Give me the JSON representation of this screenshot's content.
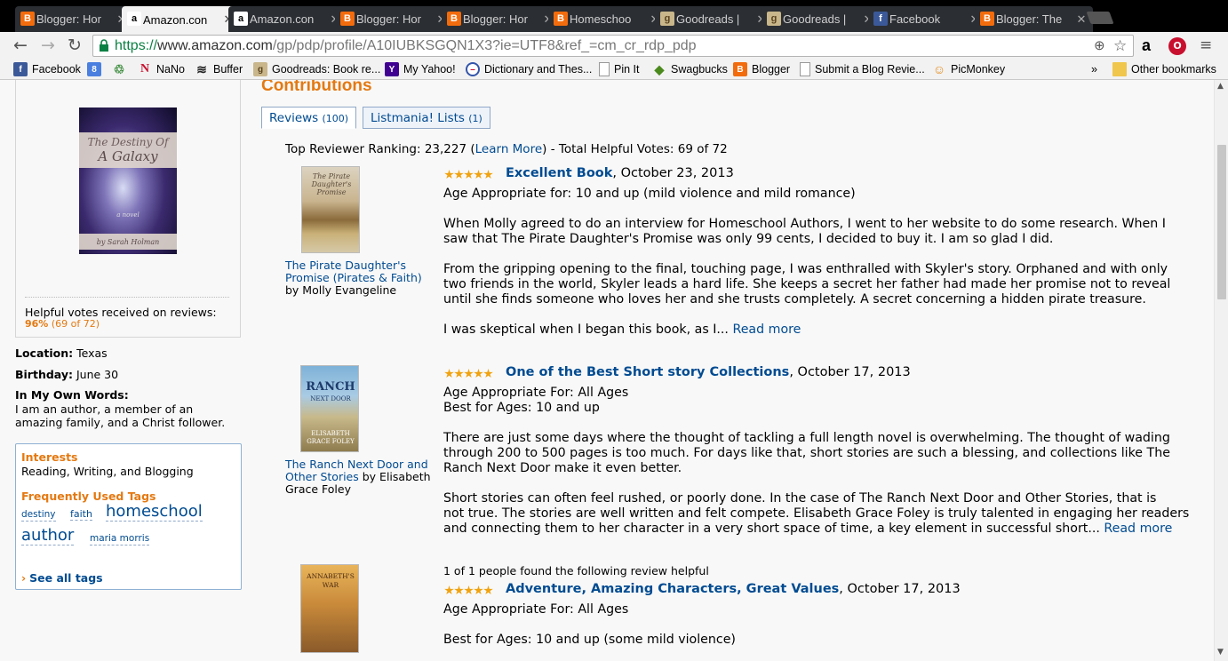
{
  "browser": {
    "tabs": [
      {
        "icon": "blogger",
        "title": "Blogger: Hor"
      },
      {
        "icon": "amazon",
        "title": "Amazon.con",
        "active": true
      },
      {
        "icon": "amazon",
        "title": "Amazon.con"
      },
      {
        "icon": "blogger",
        "title": "Blogger: Hor"
      },
      {
        "icon": "blogger",
        "title": "Blogger: Hor"
      },
      {
        "icon": "homeschool",
        "title": "Homeschoo"
      },
      {
        "icon": "goodreads",
        "title": "Goodreads |"
      },
      {
        "icon": "goodreads",
        "title": "Goodreads |"
      },
      {
        "icon": "facebook",
        "title": "Facebook"
      },
      {
        "icon": "blogger",
        "title": "Blogger: The"
      }
    ],
    "url_scheme": "https://",
    "url_host": "www.amazon.com",
    "url_path": "/gp/pdp/profile/A10IUBKSGQN1X3?ie=UTF8&ref_=cm_cr_rdp_pdp",
    "bookmarks": [
      {
        "label": "Facebook",
        "icon": "facebook"
      },
      {
        "label": "",
        "icon": "google"
      },
      {
        "label": "",
        "icon": "recycle"
      },
      {
        "label": "NaNo",
        "icon": "nano"
      },
      {
        "label": "Buffer",
        "icon": "buffer"
      },
      {
        "label": "Goodreads: Book re...",
        "icon": "goodreads"
      },
      {
        "label": "My Yahoo!",
        "icon": "yahoo"
      },
      {
        "label": "Dictionary and Thes...",
        "icon": "dictionary"
      },
      {
        "label": "Pin It",
        "icon": "page"
      },
      {
        "label": "Swagbucks",
        "icon": "swagbucks"
      },
      {
        "label": "Blogger",
        "icon": "blogger"
      },
      {
        "label": "Submit a Blog Revie...",
        "icon": "page"
      },
      {
        "label": "PicMonkey",
        "icon": "picmonkey"
      }
    ],
    "bookmarks_overflow": "»",
    "other_bookmarks": "Other bookmarks"
  },
  "profile": {
    "cover": {
      "title_line1": "The Destiny Of",
      "title_line2": "A Galaxy",
      "subtitle": "a novel",
      "author": "by Sarah Holman"
    },
    "helpful_label": "Helpful votes received on reviews:",
    "helpful_pct": "96%",
    "helpful_count": "(69 of 72)",
    "location_label": "Location:",
    "location": "Texas",
    "birthday_label": "Birthday:",
    "birthday": "June 30",
    "own_words_label": "In My Own Words:",
    "own_words": "I am an author, a member of an amazing family, and a Christ follower.",
    "interests_label": "Interests",
    "interests": "Reading, Writing, and Blogging",
    "tags_label": "Frequently Used Tags",
    "tags": [
      "destiny",
      "faith",
      "homeschool",
      "author",
      "maria morris"
    ],
    "see_all": "See all tags"
  },
  "main": {
    "heading": "Contributions",
    "tabs": [
      {
        "label": "Reviews",
        "count": "(100)"
      },
      {
        "label": "Listmania! Lists",
        "count": "(1)"
      }
    ],
    "ranking_prefix": "Top Reviewer Ranking: 23,227 (",
    "learn_more": "Learn More",
    "ranking_suffix": ") - Total Helpful Votes: 69 of 72",
    "reviews": [
      {
        "rating": 5,
        "title": "Excellent Book",
        "date": ", October 23, 2013",
        "book_title": "The Pirate Daughter's Promise (Pirates & Faith)",
        "book_author": "by Molly Evangeline",
        "cover_text": "The Pirate Daughter's Promise",
        "lines": [
          "Age Appropriate for: 10 and up (mild violence and mild romance)",
          "When Molly agreed to do an interview for Homeschool Authors, I went to her website to do some research. When I",
          "saw that The Pirate Daughter's Promise was only 99 cents, I decided to buy it. I am so glad I did.",
          "From the gripping opening to the final, touching page, I was enthralled with Skyler's story. Orphaned and with only",
          "two friends in the world, Skyler leads a hard life. She keeps a secret her father had made her promise not to reveal",
          "until she finds someone who loves her and she trusts completely. A secret concerning a hidden pirate treasure.",
          "I was skeptical when I began this book, as I..."
        ],
        "read_more": "Read more"
      },
      {
        "rating": 5,
        "title": "One of the Best Short story Collections",
        "date": ", October 17, 2013",
        "book_title": "The Ranch Next Door and Other Stories",
        "book_author": "by Elisabeth Grace Foley",
        "cover_text_top": "RANCH",
        "cover_text_sub": "NEXT DOOR",
        "cover_author": "ELISABETH GRACE FOLEY",
        "lines": [
          "Age Appropriate For: All Ages",
          "Best for Ages: 10 and up",
          "There are just some days where the thought of tackling a full length novel is overwhelming. The thought of wading",
          "through 200 to 500 pages is too much. For days like that, short stories are such a blessing, and collections like The",
          "Ranch Next Door make it even better.",
          "Short stories can often feel rushed, or poorly done. In the case of The Ranch Next Door and Other Stories, that is",
          "not true. The stories are well written and felt compete. Elisabeth Grace Foley is truly talented in engaging her readers",
          "and connecting them to her character in a very short space of time, a key element in successful short..."
        ],
        "read_more": "Read more"
      },
      {
        "helpful_note": "1 of 1 people found the following review helpful",
        "rating": 5,
        "title": "Adventure, Amazing Characters, Great Values",
        "date": ", October 17, 2013",
        "cover_text": "ANNABETH'S WAR",
        "lines": [
          "Age Appropriate For: All Ages",
          "Best for Ages: 10 and up (some mild violence)"
        ]
      }
    ]
  }
}
